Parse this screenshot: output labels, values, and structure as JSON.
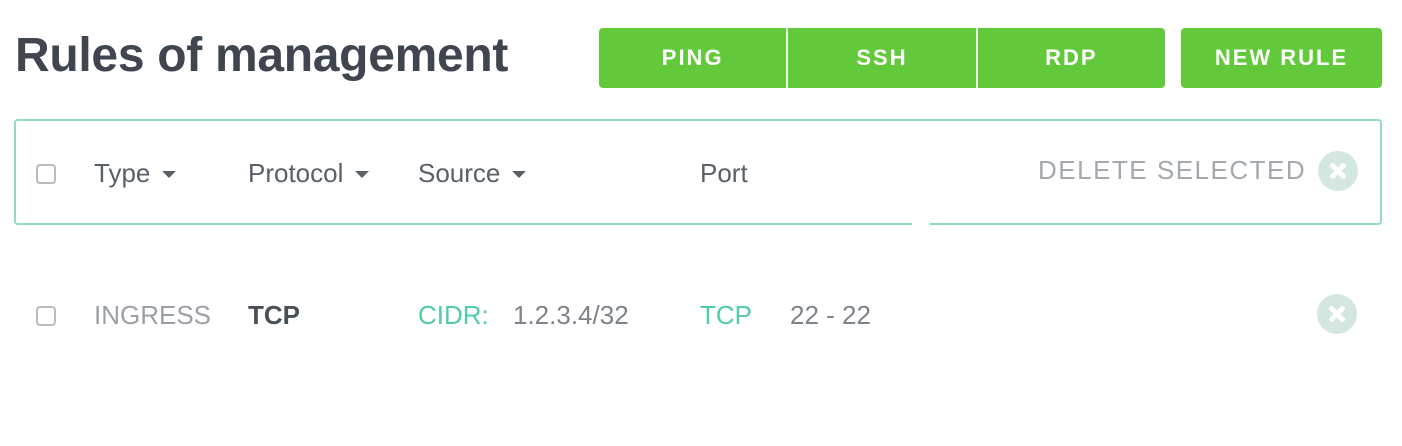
{
  "page": {
    "title": "Rules of management"
  },
  "toolbar": {
    "ping_label": "PING",
    "ssh_label": "SSH",
    "rdp_label": "RDP",
    "new_rule_label": "NEW RULE"
  },
  "table": {
    "columns": {
      "type": "Type",
      "protocol": "Protocol",
      "source": "Source",
      "port": "Port"
    },
    "delete_selected_label": "DELETE SELECTED",
    "rows": [
      {
        "type": "INGRESS",
        "protocol": "TCP",
        "source_prefix": "CIDR:",
        "source_value": "1.2.3.4/32",
        "port_protocol": "TCP",
        "port_range": "22 - 22"
      }
    ]
  },
  "colors": {
    "accent_green": "#62c93a",
    "teal": "#4fcca8",
    "border_teal": "#8fdcc3",
    "title": "#3f4650"
  },
  "icons": {
    "delete_selected": "close-circle-icon",
    "delete_row": "close-circle-icon",
    "sort": "caret-down-icon"
  }
}
